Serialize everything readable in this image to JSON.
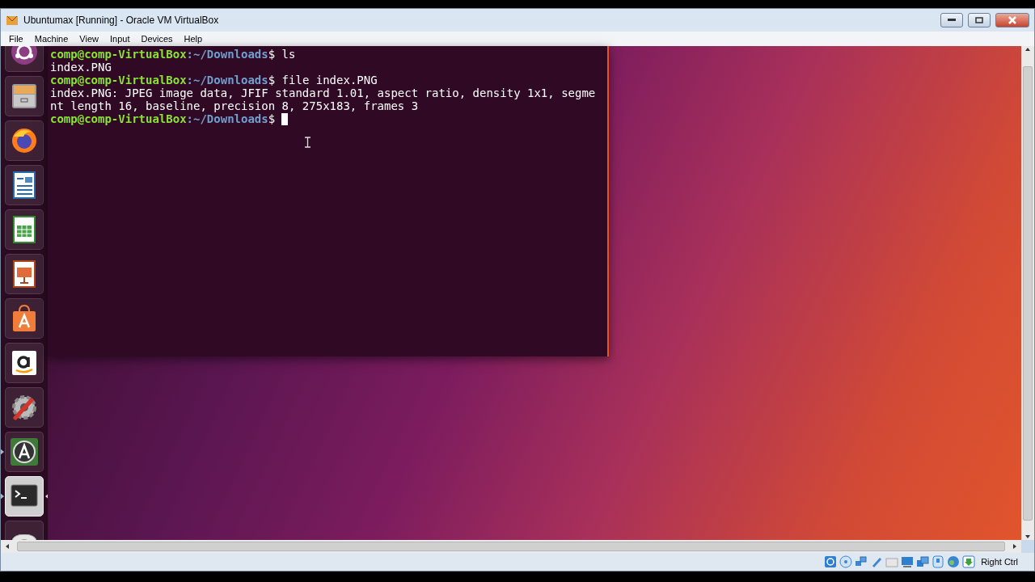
{
  "window": {
    "title": "Ubuntumax [Running] - Oracle VM VirtualBox"
  },
  "menu": [
    "File",
    "Machine",
    "View",
    "Input",
    "Devices",
    "Help"
  ],
  "launcher": [
    {
      "kind": "ubuntu",
      "running": false,
      "focused": false
    },
    {
      "kind": "files",
      "running": false,
      "focused": false
    },
    {
      "kind": "firefox",
      "running": false,
      "focused": false
    },
    {
      "kind": "writer",
      "running": false,
      "focused": false
    },
    {
      "kind": "calc",
      "running": false,
      "focused": false
    },
    {
      "kind": "impress",
      "running": false,
      "focused": false
    },
    {
      "kind": "software",
      "running": false,
      "focused": false
    },
    {
      "kind": "amazon",
      "running": false,
      "focused": false
    },
    {
      "kind": "settings",
      "running": false,
      "focused": false
    },
    {
      "kind": "updater",
      "running": true,
      "focused": false
    },
    {
      "kind": "terminal",
      "running": true,
      "focused": true
    },
    {
      "kind": "disc",
      "running": false,
      "focused": false
    }
  ],
  "terminal": {
    "lines": [
      {
        "kind": "prompt",
        "user_host": "comp@comp-VirtualBox",
        "path": ":~/Downloads",
        "command": "$ ls"
      },
      {
        "kind": "output",
        "text": "index.PNG"
      },
      {
        "kind": "prompt",
        "user_host": "comp@comp-VirtualBox",
        "path": ":~/Downloads",
        "command": "$ file index.PNG"
      },
      {
        "kind": "output",
        "text": "index.PNG: JPEG image data, JFIF standard 1.01, aspect ratio, density 1x1, segme"
      },
      {
        "kind": "output",
        "text": "nt length 16, baseline, precision 8, 275x183, frames 3"
      },
      {
        "kind": "prompt",
        "user_host": "comp@comp-VirtualBox",
        "path": ":~/Downloads",
        "command": "$"
      }
    ],
    "cursor": true
  },
  "status_bar": {
    "host_key": "Right Ctrl"
  }
}
